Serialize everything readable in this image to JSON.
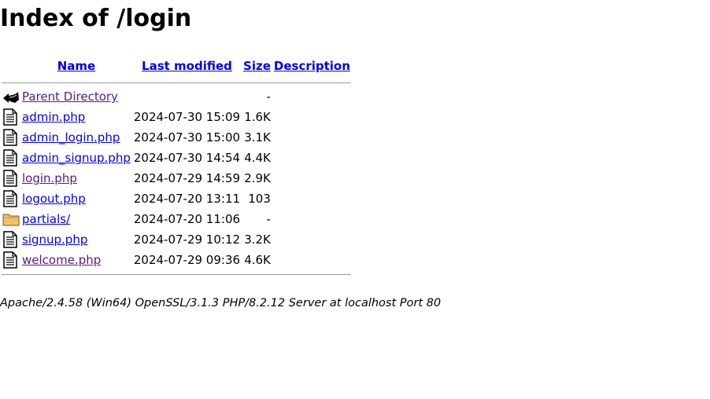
{
  "page": {
    "title": "Index of /login"
  },
  "table": {
    "headers": {
      "name": "Name",
      "last_modified": "Last modified",
      "size": "Size",
      "description": "Description"
    },
    "rows": [
      {
        "icon": "back-arrow-icon",
        "name": "Parent Directory",
        "modified": "",
        "size": "-",
        "visited": true
      },
      {
        "icon": "text-file-icon",
        "name": "admin.php",
        "modified": "2024-07-30 15:09",
        "size": "1.6K",
        "visited": false
      },
      {
        "icon": "text-file-icon",
        "name": "admin_login.php",
        "modified": "2024-07-30 15:00",
        "size": "3.1K",
        "visited": false
      },
      {
        "icon": "text-file-icon",
        "name": "admin_signup.php",
        "modified": "2024-07-30 14:54",
        "size": "4.4K",
        "visited": false
      },
      {
        "icon": "text-file-icon",
        "name": "login.php",
        "modified": "2024-07-29 14:59",
        "size": "2.9K",
        "visited": true
      },
      {
        "icon": "text-file-icon",
        "name": "logout.php",
        "modified": "2024-07-20 13:11",
        "size": "103",
        "visited": false
      },
      {
        "icon": "folder-icon",
        "name": "partials/",
        "modified": "2024-07-20 11:06",
        "size": "-",
        "visited": false
      },
      {
        "icon": "text-file-icon",
        "name": "signup.php",
        "modified": "2024-07-29 10:12",
        "size": "3.2K",
        "visited": false
      },
      {
        "icon": "text-file-icon",
        "name": "welcome.php",
        "modified": "2024-07-29 09:36",
        "size": "4.6K",
        "visited": true
      }
    ]
  },
  "footer": {
    "address": "Apache/2.4.58 (Win64) OpenSSL/3.1.3 PHP/8.2.12 Server at localhost Port 80"
  },
  "colors": {
    "link": "#0000ee",
    "visited_link": "#551a8b",
    "rule": "#9a9a9a",
    "folder": "#f5c06a"
  }
}
